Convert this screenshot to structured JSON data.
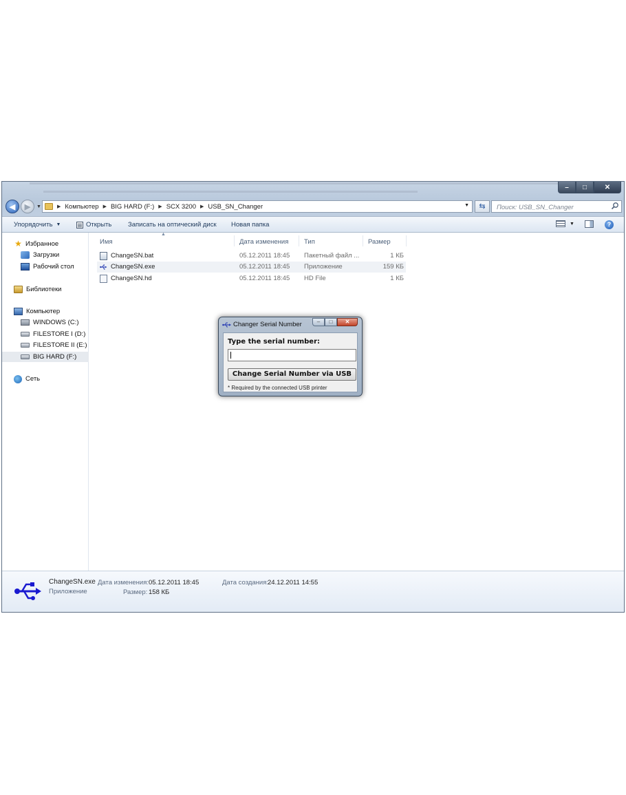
{
  "window": {
    "controls": {
      "minimize": "–",
      "maximize": "□",
      "close": "✕"
    }
  },
  "address": {
    "crumbs": [
      "Компьютер",
      "BIG HARD (F:)",
      "SCX 3200",
      "USB_SN_Changer"
    ]
  },
  "search": {
    "placeholder": "Поиск: USB_SN_Changer"
  },
  "toolbar": {
    "organize": "Упорядочить",
    "open": "Открыть",
    "burn": "Записать на оптический диск",
    "new_folder": "Новая папка"
  },
  "nav": {
    "favorites": "Избранное",
    "downloads": "Загрузки",
    "desktop": "Рабочий стол",
    "libraries": "Библиотеки",
    "computer": "Компьютер",
    "drive_c": "WINDOWS (C:)",
    "drive_d": "FILESTORE I (D:)",
    "drive_e": "FILESTORE II (E:)",
    "drive_f": "BIG HARD (F:)",
    "network": "Сеть"
  },
  "columns": {
    "name": "Имя",
    "date": "Дата изменения",
    "type": "Тип",
    "size": "Размер"
  },
  "files": [
    {
      "name": "ChangeSN.bat",
      "date": "05.12.2011 18:45",
      "type": "Пакетный файл ...",
      "size": "1 КБ",
      "icon": "batch-file-icon"
    },
    {
      "name": "ChangeSN.exe",
      "date": "05.12.2011 18:45",
      "type": "Приложение",
      "size": "159 КБ",
      "icon": "usb-icon"
    },
    {
      "name": "ChangeSN.hd",
      "date": "05.12.2011 18:45",
      "type": "HD File",
      "size": "1 КБ",
      "icon": "hd-file-icon"
    }
  ],
  "details": {
    "name": "ChangeSN.exe",
    "kind": "Приложение",
    "modified_label": "Дата изменения:",
    "modified_value": "05.12.2011 18:45",
    "created_label": "Дата создания:",
    "created_value": "24.12.2011 14:55",
    "size_label": "Размер:",
    "size_value": "158 КБ"
  },
  "dialog": {
    "title": "Changer Serial Number",
    "prompt": "Type the serial number:",
    "input_value": "",
    "button": "Change Serial Number via USB",
    "note": "* Required by the connected USB printer"
  },
  "colors": {
    "accent": "#1e395b",
    "usb_blue": "#1a1ad0"
  }
}
